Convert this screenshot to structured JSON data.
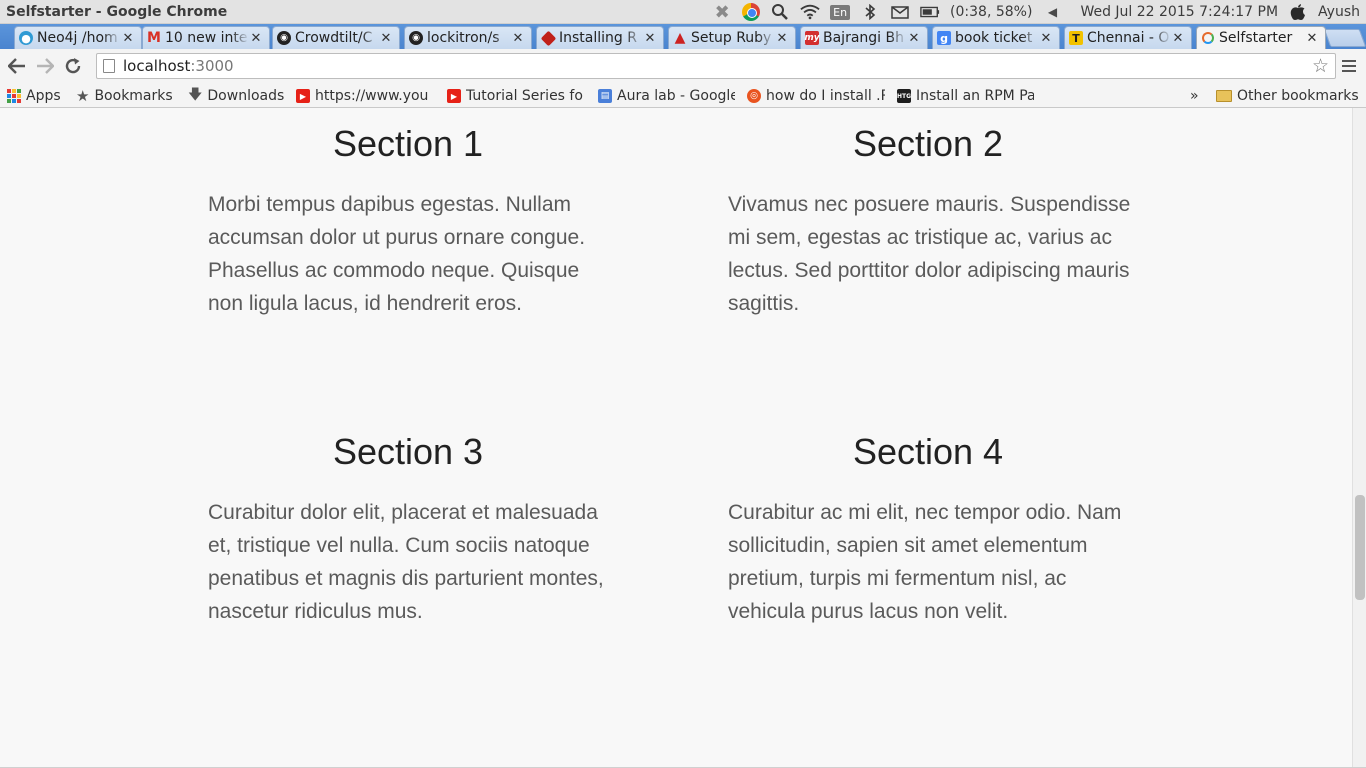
{
  "os_panel": {
    "window_title": "Selfstarter - Google Chrome",
    "battery_text": "(0:38, 58%)",
    "keyboard_layout": "En",
    "datetime": "Wed Jul 22 2015  7:24:17 PM",
    "user": "Ayush",
    "icons": [
      "close-app-icon",
      "chrome-icon",
      "search-icon",
      "wifi-icon",
      "keyboard-layout-icon",
      "bluetooth-icon",
      "mail-icon",
      "battery-icon",
      "volume-icon",
      "apple-icon"
    ]
  },
  "tabs": [
    {
      "label": "Neo4j /hom",
      "icon": "neo4j-icon",
      "color": "#2f9ad4"
    },
    {
      "label": "10 new inte",
      "icon": "gmail-icon",
      "color": "#d93025"
    },
    {
      "label": "Crowdtilt/C",
      "icon": "github-icon",
      "color": "#222222"
    },
    {
      "label": "lockitron/s",
      "icon": "github-icon",
      "color": "#222222"
    },
    {
      "label": "Installing R",
      "icon": "ruby-icon",
      "color": "#c0201a"
    },
    {
      "label": "Setup Ruby",
      "icon": "gorails-icon",
      "color": "#cc2222"
    },
    {
      "label": "Bajrangi Bh",
      "icon": "bookmyshow-icon",
      "color": "#d32f2f"
    },
    {
      "label": "book ticket",
      "icon": "google-icon",
      "color": "#4285f4"
    },
    {
      "label": "Chennai - O",
      "icon": "tripadvisor-icon",
      "color": "#f2c200"
    },
    {
      "label": "Selfstarter",
      "icon": "loading-icon",
      "color": "#e56a2c",
      "active": true
    }
  ],
  "toolbar": {
    "url_host": "localhost",
    "url_port": ":3000"
  },
  "bookmarks": [
    {
      "label": "Apps",
      "icon": "apps-icon"
    },
    {
      "label": "Bookmarks",
      "icon": "star-icon"
    },
    {
      "label": "Downloads",
      "icon": "download-icon"
    },
    {
      "label": "https://www.you",
      "icon": "youtube-icon"
    },
    {
      "label": "Tutorial Series fo",
      "icon": "youtube-icon"
    },
    {
      "label": "Aura lab - Google",
      "icon": "google-sites-icon"
    },
    {
      "label": "how do I install .R",
      "icon": "ubuntu-icon"
    },
    {
      "label": "Install an RPM Pa",
      "icon": "htg-icon"
    }
  ],
  "bookmarks_overflow": "»",
  "other_bookmarks": "Other bookmarks",
  "sections": [
    {
      "title": "Section 1",
      "body": "Morbi tempus dapibus egestas. Nullam accumsan dolor ut purus ornare congue. Phasellus ac commodo neque. Quisque non ligula lacus, id hendrerit eros."
    },
    {
      "title": "Section 2",
      "body": "Vivamus nec posuere mauris. Suspendisse mi sem, egestas ac tristique ac, varius ac lectus. Sed porttitor dolor adipiscing mauris sagittis."
    },
    {
      "title": "Section 3",
      "body": "Curabitur dolor elit, placerat et malesuada et, tristique vel nulla. Cum sociis natoque penatibus et magnis dis parturient montes, nascetur ridiculus mus."
    },
    {
      "title": "Section 4",
      "body": "Curabitur ac mi elit, nec tempor odio. Nam sollicitudin, sapien sit amet elementum pretium, turpis mi fermentum nisl, ac vehicula purus lacus non velit."
    }
  ]
}
